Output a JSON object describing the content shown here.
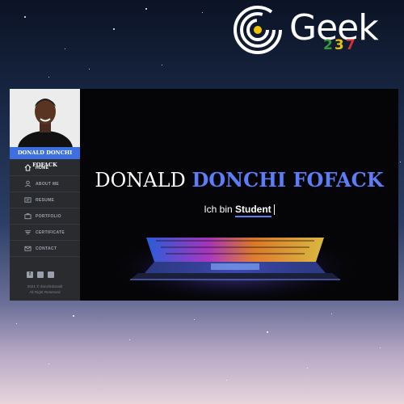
{
  "brand": {
    "logo_text": "Geek",
    "number": [
      "2",
      "3",
      "7"
    ],
    "colors": {
      "ring": "#ffffff",
      "two": "#2e9a3a",
      "three": "#e3c300",
      "seven": "#d63232",
      "dot": "#f0c400"
    }
  },
  "site": {
    "owner_name": "DONALD DONCHI FOFACK",
    "nav": [
      {
        "label": "HOME",
        "icon": "home-icon",
        "active": true
      },
      {
        "label": "ABOUT ME",
        "icon": "user-icon",
        "active": false
      },
      {
        "label": "RESUME",
        "icon": "document-icon",
        "active": false
      },
      {
        "label": "PORTFOLIO",
        "icon": "briefcase-icon",
        "active": false
      },
      {
        "label": "CERTIFICATE",
        "icon": "certificate-icon",
        "active": false
      },
      {
        "label": "CONTACT",
        "icon": "mail-icon",
        "active": false
      }
    ],
    "socials": [
      "facebook-icon",
      "twitter-icon",
      "instagram-icon"
    ],
    "copyright_line1": "2021 © donchidonald",
    "copyright_line2": "All Right Reserved",
    "hero": {
      "title_first": "DONALD",
      "title_highlight": "DONCHI FOFACK",
      "subtitle_prefix": "Ich bin",
      "subtitle_word": "Student"
    },
    "accent": "#5b7df5",
    "sidebar_bg": "#2a2b2f",
    "name_bar_bg": "#3d6fe0"
  }
}
